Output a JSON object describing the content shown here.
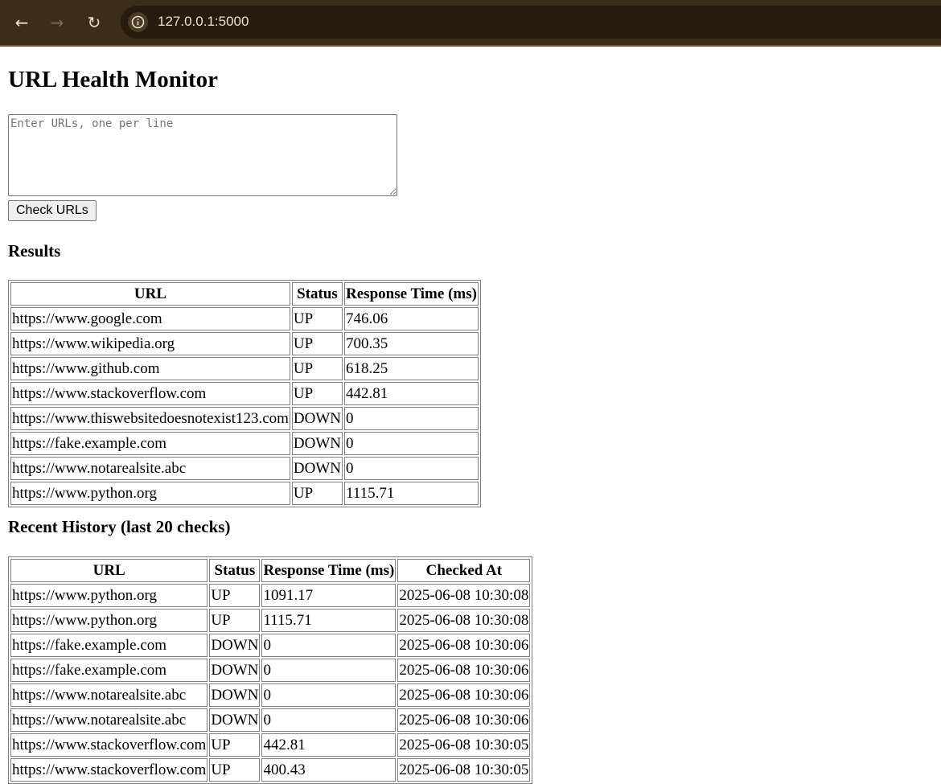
{
  "browser": {
    "url": "127.0.0.1:5000",
    "back_icon": "arrow-left-icon",
    "forward_icon": "arrow-right-icon",
    "reload_icon": "reload-icon",
    "site_info_icon": "info-icon"
  },
  "page": {
    "title": "URL Health Monitor",
    "textarea_placeholder": "Enter URLs, one per line",
    "textarea_value": "",
    "check_button": "Check URLs"
  },
  "results": {
    "heading": "Results",
    "columns": [
      "URL",
      "Status",
      "Response Time (ms)"
    ],
    "rows": [
      [
        "https://www.google.com",
        "UP",
        "746.06"
      ],
      [
        "https://www.wikipedia.org",
        "UP",
        "700.35"
      ],
      [
        "https://www.github.com",
        "UP",
        "618.25"
      ],
      [
        "https://www.stackoverflow.com",
        "UP",
        "442.81"
      ],
      [
        "https://www.thiswebsitedoesnotexist123.com",
        "DOWN",
        "0"
      ],
      [
        "https://fake.example.com",
        "DOWN",
        "0"
      ],
      [
        "https://www.notarealsite.abc",
        "DOWN",
        "0"
      ],
      [
        "https://www.python.org",
        "UP",
        "1115.71"
      ]
    ]
  },
  "history": {
    "heading": "Recent History (last 20 checks)",
    "columns": [
      "URL",
      "Status",
      "Response Time (ms)",
      "Checked At"
    ],
    "rows": [
      [
        "https://www.python.org",
        "UP",
        "1091.17",
        "2025-06-08 10:30:08"
      ],
      [
        "https://www.python.org",
        "UP",
        "1115.71",
        "2025-06-08 10:30:08"
      ],
      [
        "https://fake.example.com",
        "DOWN",
        "0",
        "2025-06-08 10:30:06"
      ],
      [
        "https://fake.example.com",
        "DOWN",
        "0",
        "2025-06-08 10:30:06"
      ],
      [
        "https://www.notarealsite.abc",
        "DOWN",
        "0",
        "2025-06-08 10:30:06"
      ],
      [
        "https://www.notarealsite.abc",
        "DOWN",
        "0",
        "2025-06-08 10:30:06"
      ],
      [
        "https://www.stackoverflow.com",
        "UP",
        "442.81",
        "2025-06-08 10:30:05"
      ],
      [
        "https://www.stackoverflow.com",
        "UP",
        "400.43",
        "2025-06-08 10:30:05"
      ]
    ]
  }
}
